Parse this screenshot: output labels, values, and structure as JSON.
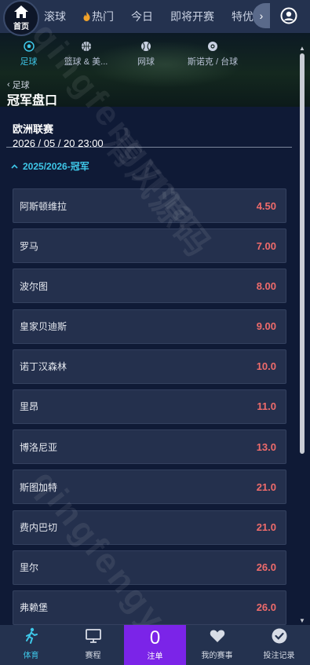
{
  "top_nav": {
    "home_label": "首页",
    "tabs": [
      {
        "label": "滚球",
        "hot": false
      },
      {
        "label": "热门",
        "hot": true
      },
      {
        "label": "今日",
        "hot": false
      },
      {
        "label": "即将开赛",
        "hot": false
      },
      {
        "label": "特优赔",
        "hot": false
      }
    ]
  },
  "sport_tabs": [
    {
      "label": "足球",
      "icon": "soccer-ball-icon",
      "active": true
    },
    {
      "label": "篮球 & 美...",
      "icon": "basketball-icon",
      "active": false
    },
    {
      "label": "网球",
      "icon": "tennis-ball-icon",
      "active": false
    },
    {
      "label": "斯诺克 / 台球",
      "icon": "billiard-ball-icon",
      "active": false
    }
  ],
  "breadcrumb": {
    "back_label": "足球"
  },
  "page_title": "冠军盘口",
  "event": {
    "name": "欧洲联赛",
    "datetime": "2026 / 05 / 20 23:00"
  },
  "market": {
    "title": "2025/2026-冠军"
  },
  "selections": [
    {
      "team": "阿斯顿维拉",
      "odds": "4.50"
    },
    {
      "team": "罗马",
      "odds": "7.00"
    },
    {
      "team": "波尔图",
      "odds": "8.00"
    },
    {
      "team": "皇家贝迪斯",
      "odds": "9.00"
    },
    {
      "team": "诺丁汉森林",
      "odds": "10.0"
    },
    {
      "team": "里昂",
      "odds": "11.0"
    },
    {
      "team": "博洛尼亚",
      "odds": "13.0"
    },
    {
      "team": "斯图加特",
      "odds": "21.0"
    },
    {
      "team": "费内巴切",
      "odds": "21.0"
    },
    {
      "team": "里尔",
      "odds": "26.0"
    },
    {
      "team": "弗赖堡",
      "odds": "26.0"
    }
  ],
  "bottom_bar": [
    {
      "label": "体育",
      "icon": "runner-icon",
      "active": true
    },
    {
      "label": "赛程",
      "icon": "monitor-icon",
      "active": false
    },
    {
      "label": "注单",
      "count": "0",
      "icon": "bet-slip-icon",
      "active": false
    },
    {
      "label": "我的赛事",
      "icon": "heart-icon",
      "active": false
    },
    {
      "label": "投注记录",
      "icon": "check-circle-icon",
      "active": false
    }
  ],
  "watermark": "qingfengyma 清风源码",
  "colors": {
    "background": "#0f1a36",
    "nav_bar": "#24324f",
    "accent": "#3ec7e8",
    "odds": "#ee6b6b",
    "bet_slip": "#7b24e8",
    "row_bg": "#24304d"
  }
}
